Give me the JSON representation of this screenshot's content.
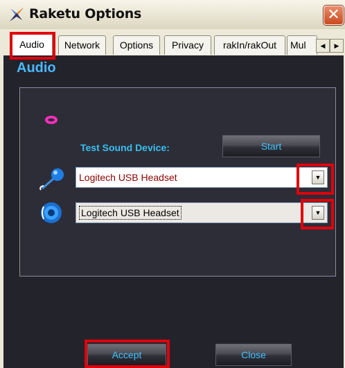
{
  "window": {
    "title": "Raketu Options",
    "close_glyph": "✕",
    "app_icon": "raketu-logo-icon"
  },
  "tabs": [
    {
      "label": "Audio",
      "active": true
    },
    {
      "label": "Network",
      "active": false
    },
    {
      "label": "Options",
      "active": false
    },
    {
      "label": "Privacy",
      "active": false
    },
    {
      "label": "rakIn/rakOut",
      "active": false
    },
    {
      "label": "Mul",
      "active": false
    }
  ],
  "tab_scroll": {
    "left_glyph": "◀",
    "right_glyph": "▶"
  },
  "audio": {
    "section_title": "Audio",
    "test_label": "Test Sound Device:",
    "start_button": "Start",
    "microphone": {
      "value": "Logitech USB Headset",
      "icon": "microphone-icon"
    },
    "speaker": {
      "value": "Logitech USB Headset",
      "icon": "speaker-icon"
    },
    "test_icon": "lips-icon",
    "dropdown_glyph": "▼"
  },
  "footer": {
    "accept_label": "Accept",
    "close_label": "Close"
  },
  "colors": {
    "accent": "#41c3ff",
    "highlight": "#e0000b",
    "panel_bg": "#2d2d37",
    "content_bg": "#23232c",
    "mic_value_color": "#8b0000"
  }
}
